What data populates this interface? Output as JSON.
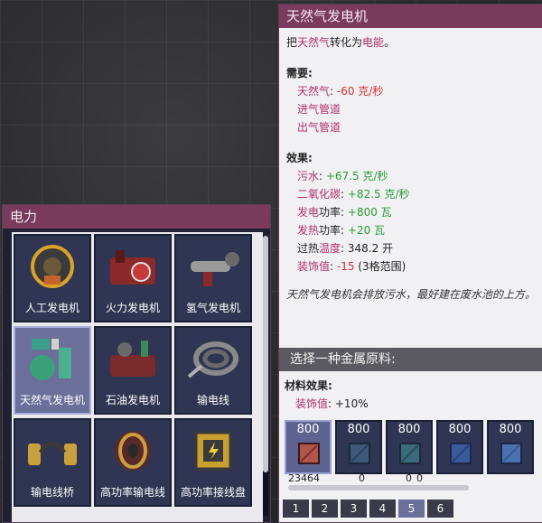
{
  "build_menu": {
    "title": "电力",
    "items": [
      {
        "label": "人工发电机",
        "icon": "manual-generator-icon",
        "selected": false
      },
      {
        "label": "火力发电机",
        "icon": "coal-generator-icon",
        "selected": false
      },
      {
        "label": "氢气发电机",
        "icon": "hydrogen-generator-icon",
        "selected": false
      },
      {
        "label": "天然气发电机",
        "icon": "natural-gas-generator-icon",
        "selected": true
      },
      {
        "label": "石油发电机",
        "icon": "petroleum-generator-icon",
        "selected": false
      },
      {
        "label": "输电线",
        "icon": "wire-icon",
        "selected": false
      },
      {
        "label": "输电线桥",
        "icon": "wire-bridge-icon",
        "selected": false
      },
      {
        "label": "高功率输电线",
        "icon": "heavy-wire-icon",
        "selected": false
      },
      {
        "label": "高功率接线盘",
        "icon": "heavy-wire-joint-plate-icon",
        "selected": false
      }
    ]
  },
  "info": {
    "title": "天然气发电机",
    "description": {
      "prefix": "把",
      "gas": "天然气",
      "mid": "转化为",
      "power": "电能",
      "suffix": "。"
    },
    "requirements_title": "需要:",
    "requirements": [
      {
        "name": "天然气",
        "sep": ": ",
        "value": "-60 克/秒"
      },
      {
        "name": "进气管道"
      },
      {
        "name": "出气管道"
      }
    ],
    "effects_title": "效果:",
    "effects": [
      {
        "name": "污水",
        "suffix": "",
        "sep": ": ",
        "value": "+67.5 克/秒",
        "kind": "green"
      },
      {
        "name": "二氧化碳",
        "suffix": "",
        "sep": ": ",
        "value": "+82.5 克/秒",
        "kind": "green"
      },
      {
        "name": "发电",
        "suffix": "功率",
        "sep": ": ",
        "value": "+800 瓦",
        "kind": "green"
      },
      {
        "name": "发热",
        "suffix": "功率",
        "sep": ": ",
        "value": "+20 瓦",
        "kind": "green"
      },
      {
        "name": "温度",
        "prefix": "过热",
        "sep": ": ",
        "value": "348.2 开",
        "kind": "plain"
      },
      {
        "name": "装饰值",
        "sep": ": ",
        "value": "-15",
        "extra": " (3格范围)",
        "kind": "red"
      }
    ],
    "flavor": "天然气发电机会排放污水，最好建在废水池的上方。"
  },
  "materials": {
    "header": "选择一种金属原料:",
    "effects_title": "材料效果:",
    "effect_name": "装饰值",
    "effect_sep": ": ",
    "effect_value": "+10%",
    "options": [
      {
        "cost": "800",
        "count": "23464",
        "color": "#b0564a",
        "selected": true
      },
      {
        "cost": "800",
        "count": "0",
        "color": "#3e5a7a",
        "selected": false
      },
      {
        "cost": "800",
        "count": "0",
        "color": "#3b6a7a",
        "selected": false
      },
      {
        "cost": "800",
        "count": "0",
        "color": "#3a5a9a",
        "selected": false
      },
      {
        "cost": "800",
        "count": "",
        "color": "#4a72b0",
        "selected": false
      }
    ],
    "pages": [
      "1",
      "2",
      "3",
      "4",
      "5",
      "6"
    ],
    "active_page": "5"
  },
  "colors": {
    "header": "#7a3a5c",
    "pink": "#b0306a",
    "red": "#d8302e",
    "green": "#2a9a34"
  }
}
